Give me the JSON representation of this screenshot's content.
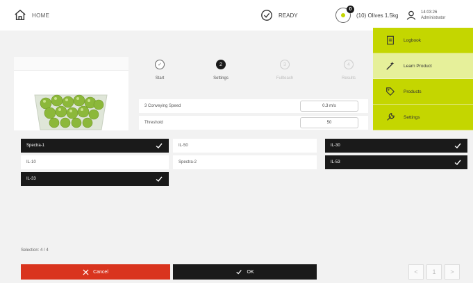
{
  "header": {
    "home_label": "HOME",
    "status_label": "READY",
    "product_badge": "0",
    "product_label": "(10) Olives 1.5kg",
    "user_time": "14:03:26",
    "user_role": "Administrator"
  },
  "stepper": {
    "steps": [
      {
        "label": "Start",
        "state": "done",
        "symbol": "✓"
      },
      {
        "label": "Settings",
        "state": "active",
        "symbol": "2"
      },
      {
        "label": "Fullteach",
        "state": "pending",
        "symbol": "3"
      },
      {
        "label": "Results",
        "state": "pending",
        "symbol": "4"
      }
    ]
  },
  "params": [
    {
      "name": "3 Conveying Speed",
      "value": "0.3 m/s"
    },
    {
      "name": "Threshold",
      "value": "50"
    }
  ],
  "side_menu": {
    "items": [
      {
        "label": "Logbook",
        "icon": "logbook-icon"
      },
      {
        "label": "Learn Product",
        "icon": "wand-icon"
      },
      {
        "label": "Products",
        "icon": "tag-icon"
      },
      {
        "label": "Settings",
        "icon": "wrench-icon"
      }
    ]
  },
  "dialog": {
    "options": [
      {
        "label": "Spectra-1",
        "selected": true
      },
      {
        "label": "IL-50",
        "selected": false
      },
      {
        "label": "IL-30",
        "selected": true
      },
      {
        "label": "IL-10",
        "selected": false
      },
      {
        "label": "Spectra-2",
        "selected": false
      },
      {
        "label": "IL-53",
        "selected": true
      },
      {
        "label": "IL-33",
        "selected": true
      }
    ],
    "selection_text": "Selection: 4 / 4",
    "cancel_label": "Cancel",
    "ok_label": "OK",
    "page_prev": "<",
    "page_current": "1",
    "page_next": ">"
  },
  "colors": {
    "accent": "#c4d600",
    "accent_light": "#e6f09a",
    "cancel": "#d9341e",
    "dark": "#1a1a1a"
  }
}
